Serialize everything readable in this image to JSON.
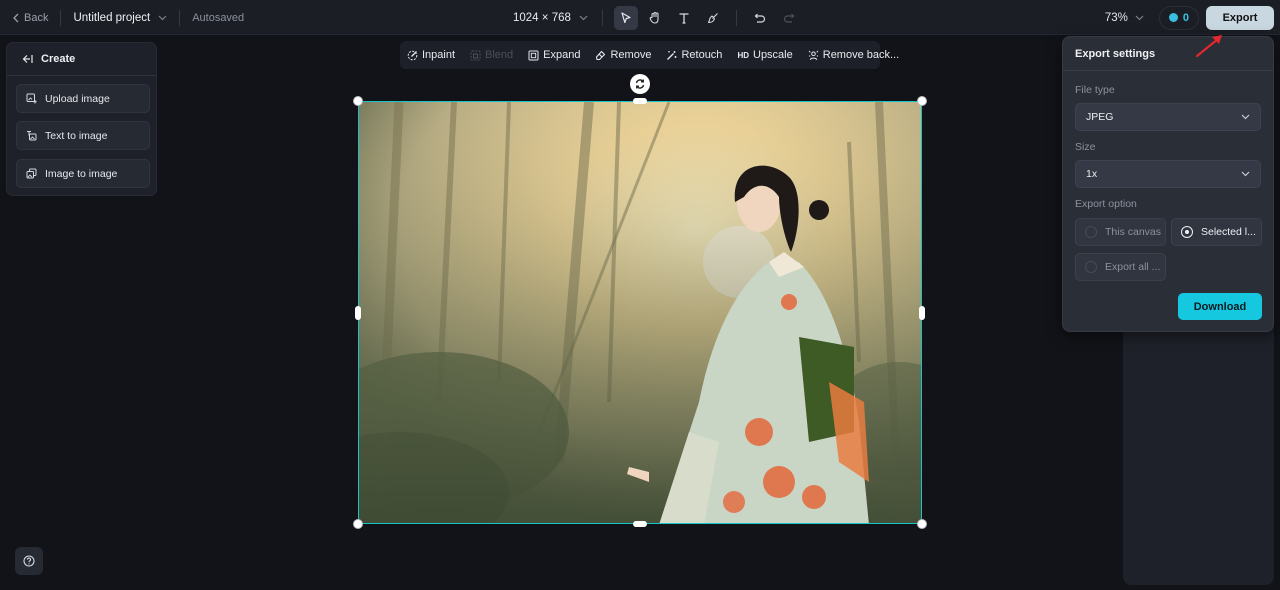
{
  "topbar": {
    "back_label": "Back",
    "project_title": "Untitled project",
    "save_status": "Autosaved",
    "canvas_dimensions": "1024 × 768",
    "zoom_level": "73%",
    "credits": "0",
    "export_label": "Export",
    "tools": [
      "select-tool",
      "hand-tool",
      "text-tool",
      "brush-tool",
      "undo",
      "redo"
    ]
  },
  "create_panel": {
    "title": "Create",
    "items": [
      {
        "label": "Upload image",
        "icon": "upload-image-icon"
      },
      {
        "label": "Text to image",
        "icon": "text-to-image-icon"
      },
      {
        "label": "Image to image",
        "icon": "image-to-image-icon"
      }
    ]
  },
  "edit_toolbar": {
    "items": [
      {
        "label": "Inpaint",
        "icon": "inpaint-icon",
        "enabled": true
      },
      {
        "label": "Blend",
        "icon": "blend-icon",
        "enabled": false
      },
      {
        "label": "Expand",
        "icon": "expand-icon",
        "enabled": true
      },
      {
        "label": "Remove",
        "icon": "eraser-icon",
        "enabled": true
      },
      {
        "label": "Retouch",
        "icon": "magic-wand-icon",
        "enabled": true
      },
      {
        "label": "Upscale",
        "icon": "hd-icon",
        "icon_text": "HD",
        "enabled": true
      },
      {
        "label": "Remove back...",
        "icon": "remove-background-icon",
        "enabled": true
      }
    ]
  },
  "export_settings": {
    "title": "Export settings",
    "file_type_label": "File type",
    "file_type_value": "JPEG",
    "size_label": "Size",
    "size_value": "1x",
    "export_option_label": "Export option",
    "options": [
      {
        "label": "This canvas",
        "selected": false
      },
      {
        "label": "Selected l...",
        "selected": true
      },
      {
        "label": "Export all ...",
        "selected": false
      }
    ],
    "download_label": "Download"
  },
  "colors": {
    "accent": "#16c7e0",
    "selection": "#18c4c8",
    "export_button": "#c9d7e0",
    "annotation_arrow": "#e0282e"
  }
}
